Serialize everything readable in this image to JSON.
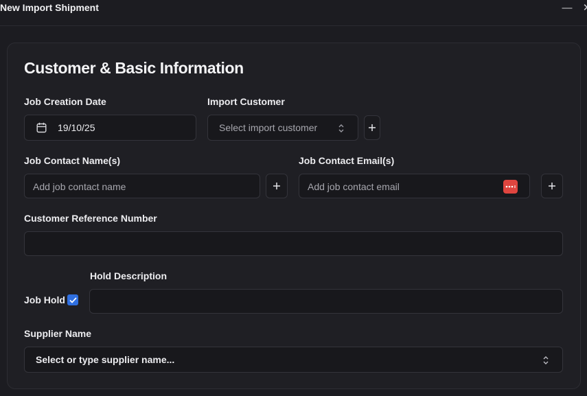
{
  "window": {
    "title": "New Import Shipment",
    "minimize_glyph": "—",
    "close_glyph": "✕"
  },
  "section": {
    "title": "Customer & Basic Information"
  },
  "fields": {
    "job_creation_date": {
      "label": "Job Creation Date",
      "value": "19/10/25",
      "icon": "calendar-icon"
    },
    "import_customer": {
      "label": "Import Customer",
      "placeholder": "Select import customer",
      "icon": "chevron-up-down-icon"
    },
    "job_contact_name": {
      "label": "Job Contact Name(s)",
      "placeholder": "Add job contact name"
    },
    "job_contact_email": {
      "label": "Job Contact Email(s)",
      "placeholder": "Add job contact email",
      "icon": "password-manager-icon"
    },
    "customer_reference": {
      "label": "Customer Reference Number",
      "value": ""
    },
    "job_hold": {
      "label": "Job Hold",
      "checked": true
    },
    "hold_description": {
      "label": "Hold Description",
      "value": ""
    },
    "supplier_name": {
      "label": "Supplier Name",
      "placeholder": "Select or type supplier name...",
      "icon": "chevron-up-down-icon"
    }
  },
  "colors": {
    "background": "#1c1c21",
    "card": "#1f1f24",
    "input": "#18181c",
    "border": "#34343b",
    "accent_checkbox": "#2f6fe0",
    "password_icon": "#e0453f"
  }
}
